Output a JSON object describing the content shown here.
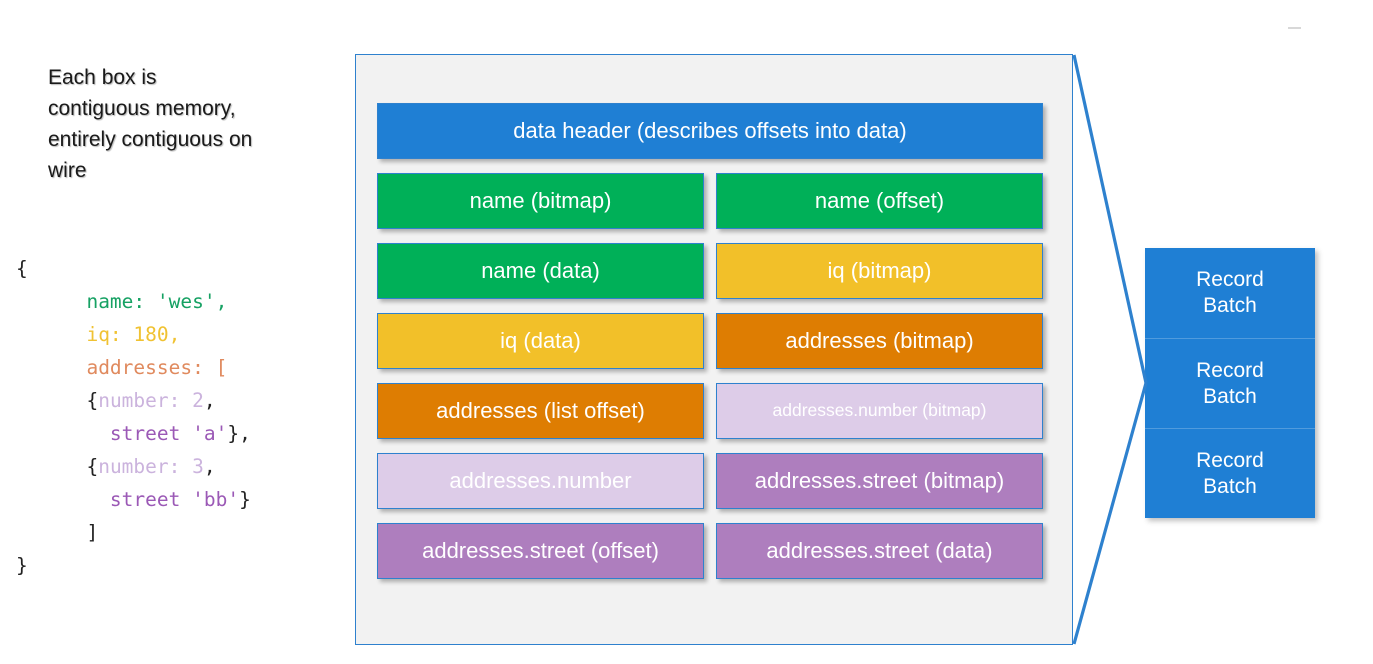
{
  "caption": {
    "text": "Each box is\ncontiguous memory,\nentirely contiguous on\nwire"
  },
  "code": {
    "lines": [
      [
        {
          "t": "{",
          "c": "#222222"
        }
      ],
      [
        {
          "t": "      ",
          "c": "#222222"
        },
        {
          "t": "name: 'wes',",
          "c": "#16a163"
        }
      ],
      [
        {
          "t": "      ",
          "c": "#222222"
        },
        {
          "t": "iq: 180,",
          "c": "#f0c232"
        }
      ],
      [
        {
          "t": "      ",
          "c": "#222222"
        },
        {
          "t": "addresses: [",
          "c": "#e08a5e"
        }
      ],
      [
        {
          "t": "      ",
          "c": "#222222"
        },
        {
          "t": "{",
          "c": "#222222"
        },
        {
          "t": "number: 2",
          "c": "#cbb3dd"
        },
        {
          "t": ",",
          "c": "#222222"
        }
      ],
      [
        {
          "t": "        ",
          "c": "#222222"
        },
        {
          "t": "street 'a'",
          "c": "#9b59b6"
        },
        {
          "t": "},",
          "c": "#222222"
        }
      ],
      [
        {
          "t": "      ",
          "c": "#222222"
        },
        {
          "t": "{",
          "c": "#222222"
        },
        {
          "t": "number: 3",
          "c": "#cbb3dd"
        },
        {
          "t": ",",
          "c": "#222222"
        }
      ],
      [
        {
          "t": "        ",
          "c": "#222222"
        },
        {
          "t": "street 'bb'",
          "c": "#9b59b6"
        },
        {
          "t": "}",
          "c": "#222222"
        }
      ],
      [
        {
          "t": "      ]",
          "c": "#222222"
        }
      ],
      [
        {
          "t": "}",
          "c": "#222222"
        }
      ]
    ]
  },
  "colors": {
    "blue": "#1F7FD4",
    "green": "#00B058",
    "amber": "#F2C029",
    "orange": "#DE7D02",
    "lavender": "#DDCCE8",
    "purple": "#AE7EBE",
    "border": "#2E81CE",
    "panel_bg": "#F2F2F2"
  },
  "memory_layout": {
    "rows": [
      {
        "cells": [
          {
            "label": "data header (describes offsets into data)",
            "color": "#1F7FD4",
            "span": "full",
            "text_size": "normal"
          }
        ]
      },
      {
        "cells": [
          {
            "label": "name (bitmap)",
            "color": "#00B058",
            "span": "left",
            "text_size": "normal"
          },
          {
            "label": "name (offset)",
            "color": "#00B058",
            "span": "right",
            "text_size": "normal"
          }
        ]
      },
      {
        "cells": [
          {
            "label": "name (data)",
            "color": "#00B058",
            "span": "left",
            "text_size": "normal"
          },
          {
            "label": "iq (bitmap)",
            "color": "#F2C029",
            "span": "right",
            "text_size": "normal"
          }
        ]
      },
      {
        "cells": [
          {
            "label": "iq (data)",
            "color": "#F2C029",
            "span": "left",
            "text_size": "normal"
          },
          {
            "label": "addresses (bitmap)",
            "color": "#DE7D02",
            "span": "right",
            "text_size": "normal"
          }
        ]
      },
      {
        "cells": [
          {
            "label": "addresses (list offset)",
            "color": "#DE7D02",
            "span": "left",
            "text_size": "normal"
          },
          {
            "label": "addresses.number (bitmap)",
            "color": "#DDCCE8",
            "span": "right",
            "text_size": "small"
          }
        ]
      },
      {
        "cells": [
          {
            "label": "addresses.number",
            "color": "#DDCCE8",
            "span": "left",
            "text_size": "normal"
          },
          {
            "label": "addresses.street (bitmap)",
            "color": "#AE7EBE",
            "span": "right",
            "text_size": "normal"
          }
        ]
      },
      {
        "cells": [
          {
            "label": "addresses.street (offset)",
            "color": "#AE7EBE",
            "span": "left",
            "text_size": "normal"
          },
          {
            "label": "addresses.street (data)",
            "color": "#AE7EBE",
            "span": "right",
            "text_size": "normal"
          }
        ]
      }
    ]
  },
  "record_batch_panel": {
    "color": "#1F7FD4",
    "segments": [
      {
        "line1": "Record",
        "line2": "Batch"
      },
      {
        "line1": "Record",
        "line2": "Batch"
      },
      {
        "line1": "Record",
        "line2": "Batch"
      }
    ]
  }
}
